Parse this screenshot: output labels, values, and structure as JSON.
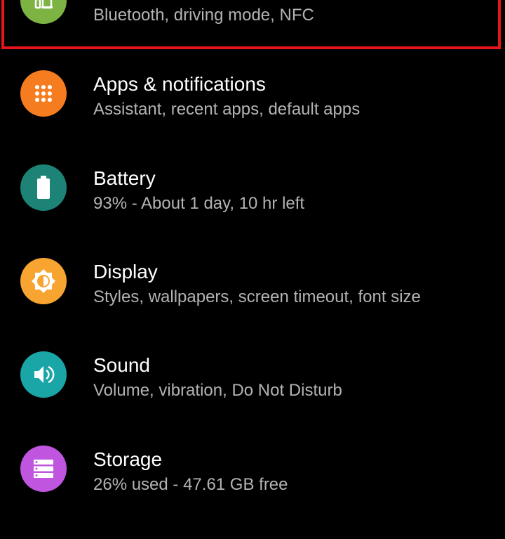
{
  "colors": {
    "background": "#000000",
    "title": "#ffffff",
    "subtitle": "#b3b3b3",
    "highlight": "#e8141c"
  },
  "items": [
    {
      "title": "",
      "subtitle": "Bluetooth, driving mode, NFC",
      "icon": "connected-devices-icon",
      "color": "#7cb342"
    },
    {
      "title": "Apps & notifications",
      "subtitle": "Assistant, recent apps, default apps",
      "icon": "apps-grid-icon",
      "color": "#f57c1f"
    },
    {
      "title": "Battery",
      "subtitle": "93% - About 1 day, 10 hr left",
      "icon": "battery-icon",
      "color": "#1d8377"
    },
    {
      "title": "Display",
      "subtitle": "Styles, wallpapers, screen timeout, font size",
      "icon": "brightness-icon",
      "color": "#f7a530"
    },
    {
      "title": "Sound",
      "subtitle": "Volume, vibration, Do Not Disturb",
      "icon": "volume-icon",
      "color": "#1aa5a7"
    },
    {
      "title": "Storage",
      "subtitle": "26% used - 47.61 GB free",
      "icon": "storage-icon",
      "color": "#c055e0"
    }
  ]
}
